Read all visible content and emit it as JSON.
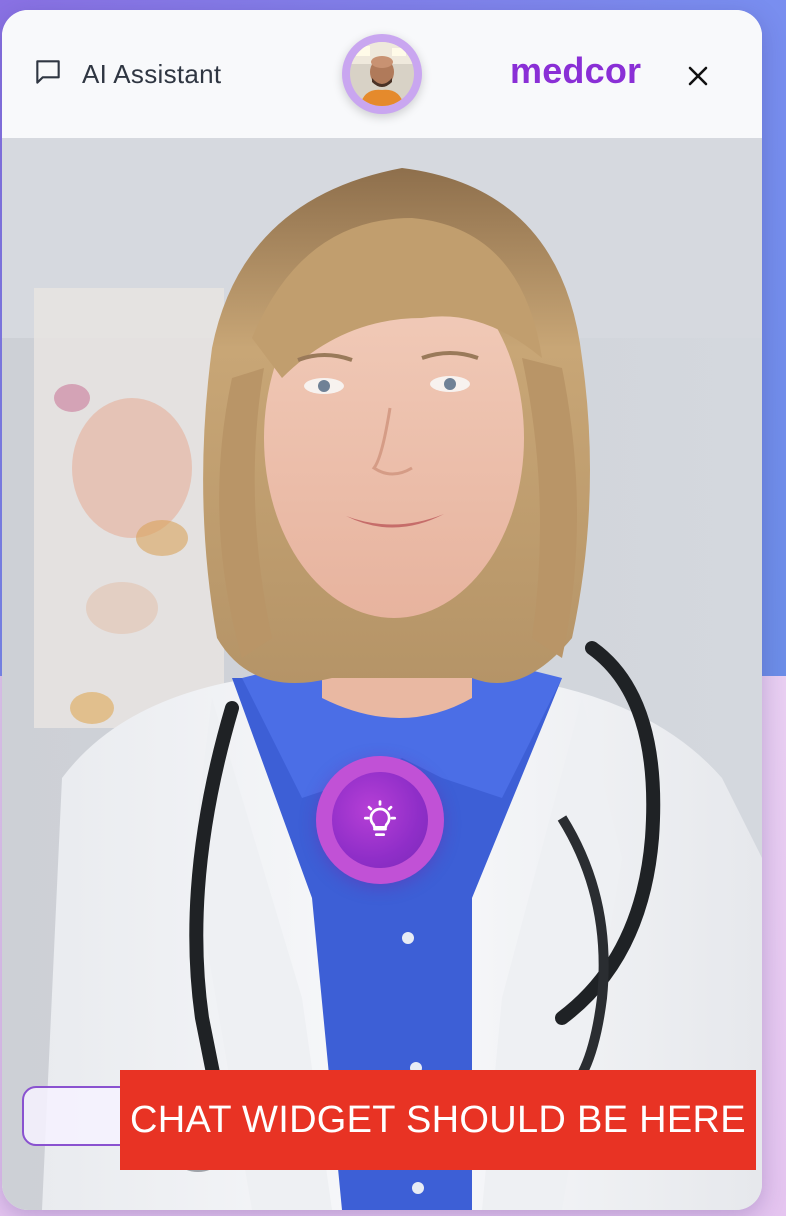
{
  "header": {
    "assistant_label": "AI Assistant",
    "brand": "medcor",
    "icons": {
      "chat": "chat-bubble-icon",
      "close": "close-icon"
    }
  },
  "main": {
    "idea_button_icon": "lightbulb-icon",
    "overlay_text": "CHAT WIDGET SHOULD BE HERE"
  },
  "colors": {
    "brand_purple": "#8a2fd6",
    "overlay_red": "#e83324",
    "avatar_ring": "#c9a6f0",
    "idea_ring": "#c151d6"
  }
}
